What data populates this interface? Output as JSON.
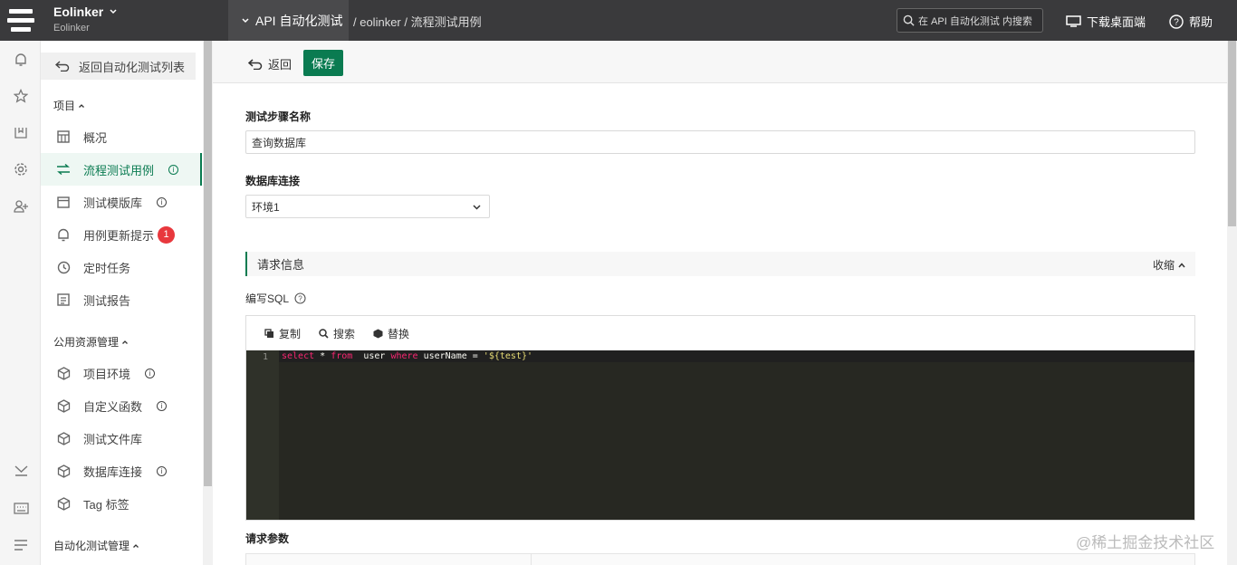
{
  "topbar": {
    "workspace": "Eolinker",
    "workspace_sub": "Eolinker",
    "module": "API 自动化测试",
    "breadcrumb": "/ eolinker / 流程测试用例",
    "search_placeholder": "在 API 自动化测试 内搜索",
    "download": "下载桌面端",
    "help": "帮助"
  },
  "rail_icons": [
    "bell-icon",
    "star-icon",
    "map-icon",
    "gear-icon",
    "add-user-icon",
    "download-icon",
    "keyboard-icon",
    "menu-icon"
  ],
  "sidebar": {
    "back_to_list": "返回自动化测试列表",
    "project_group": "项目",
    "items": [
      {
        "label": "概况",
        "icon": "dashboard-icon"
      },
      {
        "label": "流程测试用例",
        "icon": "flow-icon",
        "info": "i",
        "active": true
      },
      {
        "label": "测试模版库",
        "icon": "template-icon",
        "info": "i"
      },
      {
        "label": "用例更新提示",
        "icon": "bell-icon",
        "badge": "1"
      },
      {
        "label": "定时任务",
        "icon": "clock-icon"
      },
      {
        "label": "测试报告",
        "icon": "report-icon"
      }
    ],
    "resource_group": "公用资源管理",
    "resources": [
      {
        "label": "项目环境",
        "icon": "cube-icon",
        "info": "i"
      },
      {
        "label": "自定义函数",
        "icon": "cube-icon",
        "info": "i"
      },
      {
        "label": "测试文件库",
        "icon": "cube-icon"
      },
      {
        "label": "数据库连接",
        "icon": "cube-icon",
        "info": "i"
      },
      {
        "label": "Tag 标签",
        "icon": "cube-icon"
      }
    ],
    "auto_group": "自动化测试管理"
  },
  "toolbar": {
    "back": "返回",
    "save": "保存"
  },
  "form": {
    "step_name_label": "测试步骤名称",
    "step_name_value": "查询数据库",
    "db_label": "数据库连接",
    "db_value": "环境1",
    "section_title": "请求信息",
    "collapse": "收缩",
    "sql_label": "编写SQL",
    "editor_actions": {
      "copy": "复制",
      "search": "搜索",
      "replace": "替换"
    },
    "line_number": "1",
    "code": {
      "kw1": "select",
      "star": " * ",
      "kw2": "from",
      "mid": "  user ",
      "kw3": "where",
      "cond": " userName = ",
      "str": "'${test}'"
    },
    "params_label": "请求参数"
  },
  "watermark": "@稀土掘金技术社区",
  "colors": {
    "accent": "#0a7b51",
    "topbar": "#3a3a3c",
    "badge": "#e8383d",
    "editor_bg": "#272822"
  }
}
